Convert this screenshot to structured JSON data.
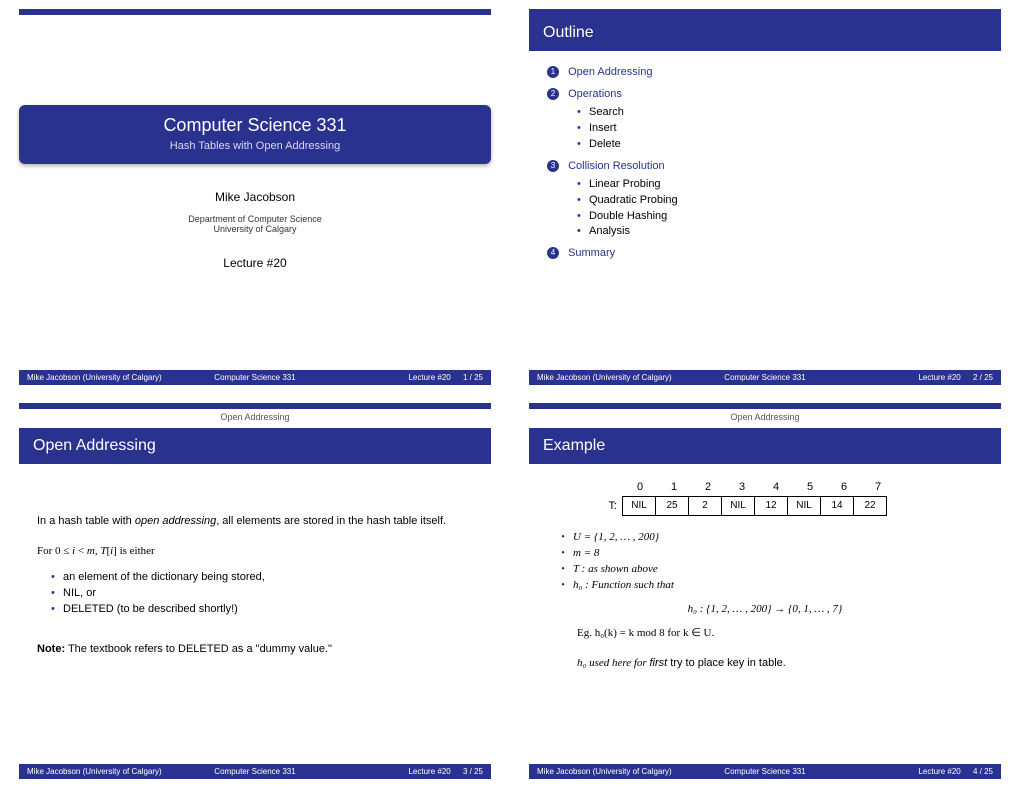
{
  "footer": {
    "author": "Mike Jacobson   (University of Calgary)",
    "course": "Computer Science 331",
    "lecture": "Lecture #20"
  },
  "slide1": {
    "title": "Computer Science 331",
    "subtitle": "Hash Tables with Open Addressing",
    "author": "Mike Jacobson",
    "dept1": "Department of Computer Science",
    "dept2": "University of Calgary",
    "lecture": "Lecture #20",
    "page": "1 / 25"
  },
  "slide2": {
    "heading": "Outline",
    "items": [
      {
        "n": "1",
        "label": "Open Addressing",
        "sub": []
      },
      {
        "n": "2",
        "label": "Operations",
        "sub": [
          "Search",
          "Insert",
          "Delete"
        ]
      },
      {
        "n": "3",
        "label": "Collision Resolution",
        "sub": [
          "Linear Probing",
          "Quadratic Probing",
          "Double Hashing",
          "Analysis"
        ]
      },
      {
        "n": "4",
        "label": "Summary",
        "sub": []
      }
    ],
    "page": "2 / 25"
  },
  "slide3": {
    "crumb": "Open Addressing",
    "heading": "Open Addressing",
    "p1a": "In a hash table with ",
    "p1b": "open addressing",
    "p1c": ", all elements are stored in the hash table itself.",
    "p2": "For 0 ≤ i < m, T[i] is either",
    "bullets": [
      "an element of the dictionary being stored,",
      "NIL, or",
      "DELETED (to be described shortly!)"
    ],
    "note_label": "Note:",
    "note_text": " The textbook refers to DELETED as a \"dummy value.\"",
    "page": "3 / 25"
  },
  "slide4": {
    "crumb": "Open Addressing",
    "heading": "Example",
    "indices": [
      "0",
      "1",
      "2",
      "3",
      "4",
      "5",
      "6",
      "7"
    ],
    "tlabel": "T:",
    "cells": [
      "NIL",
      "25",
      "2",
      "NIL",
      "12",
      "NIL",
      "14",
      "22"
    ],
    "b1": "U = {1, 2, … , 200}",
    "b2": "m = 8",
    "b3": "T : as shown above",
    "b4": "h₀ : Function such that",
    "mapline": "h₀ : {1, 2, … , 200} → {0, 1, … , 7}",
    "egline": "Eg. h₀(k) = k mod 8 for k ∈ U.",
    "lastline_a": "h₀ used here for ",
    "lastline_b": "first",
    "lastline_c": " try to place key in table.",
    "page": "4 / 25"
  }
}
